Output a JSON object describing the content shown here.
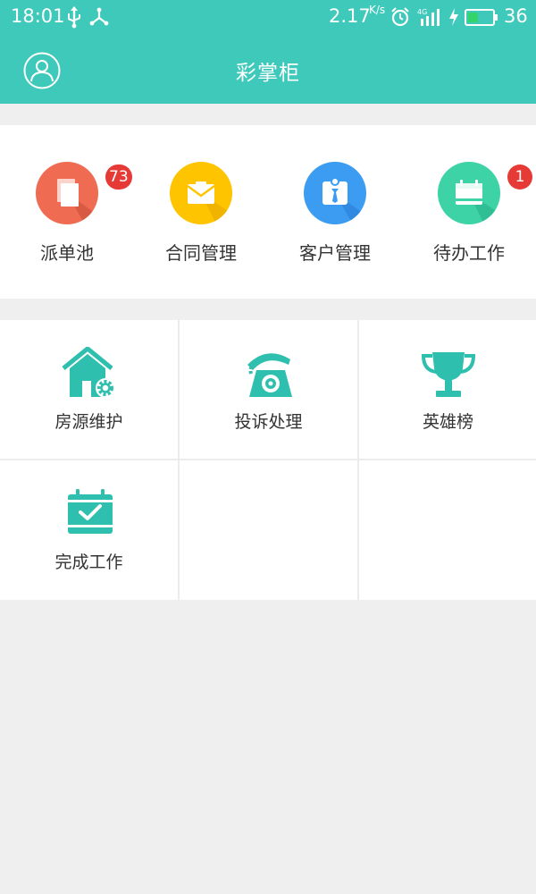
{
  "status_bar": {
    "time": "18:01",
    "speed": "2.17",
    "speed_unit": "K/s",
    "battery": "36"
  },
  "header": {
    "title": "彩掌柜"
  },
  "quick_actions": [
    {
      "label": "派单池",
      "badge": "73",
      "color": "#ef6b52",
      "icon": "copy-icon"
    },
    {
      "label": "合同管理",
      "badge": "",
      "color": "#ffc400",
      "icon": "envelope-icon"
    },
    {
      "label": "客户管理",
      "badge": "",
      "color": "#3b9cf1",
      "icon": "person-tie-icon"
    },
    {
      "label": "待办工作",
      "badge": "1",
      "color": "#3dd3a7",
      "icon": "calendar-icon"
    }
  ],
  "grid_items": [
    {
      "label": "房源维护",
      "icon": "house-gear-icon"
    },
    {
      "label": "投诉处理",
      "icon": "telephone-icon"
    },
    {
      "label": "英雄榜",
      "icon": "trophy-icon"
    },
    {
      "label": "完成工作",
      "icon": "calendar-check-icon"
    }
  ],
  "colors": {
    "header": "#3ec9bb",
    "icon_teal": "#2fbfae",
    "badge": "#e53a35",
    "background": "#efefef"
  }
}
